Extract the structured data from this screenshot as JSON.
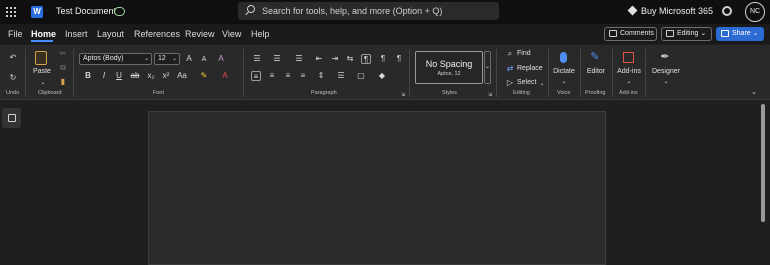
{
  "titlebar": {
    "document_title": "Test Document",
    "search_placeholder": "Search for tools, help, and more (Option + Q)",
    "buy_label": "Buy Microsoft 365",
    "avatar_initials": "NC"
  },
  "tabs": [
    {
      "label": "File"
    },
    {
      "label": "Home",
      "active": true
    },
    {
      "label": "Insert"
    },
    {
      "label": "Layout"
    },
    {
      "label": "References"
    },
    {
      "label": "Review"
    },
    {
      "label": "View"
    },
    {
      "label": "Help"
    }
  ],
  "actions": {
    "comments_label": "Comments",
    "editing_label": "Editing",
    "share_label": "Share"
  },
  "ribbon": {
    "undo_group": "Undo",
    "clipboard": {
      "paste_label": "Paste",
      "group_label": "Clipboard"
    },
    "font": {
      "font_name": "Aptos (Body)",
      "font_size": "12",
      "group_label": "Font"
    },
    "paragraph": {
      "group_label": "Paragraph"
    },
    "styles": {
      "current_style": "No Spacing",
      "current_style_font": "Aptos, 12",
      "group_label": "Styles"
    },
    "editing": {
      "find_label": "Find",
      "replace_label": "Replace",
      "select_label": "Select",
      "group_label": "Editing"
    },
    "voice": {
      "dictate_label": "Dictate",
      "group_label": "Voice"
    },
    "proofing": {
      "editor_label": "Editor",
      "group_label": "Proofing"
    },
    "addins": {
      "addins_label": "Add-ins",
      "group_label": "Add-ins"
    },
    "designer": {
      "designer_label": "Designer"
    }
  },
  "colors": {
    "accent": "#2c6bd4",
    "tab_underline": "#4a8bff",
    "page": "#2b2b2b",
    "background": "#1f1f1f"
  }
}
